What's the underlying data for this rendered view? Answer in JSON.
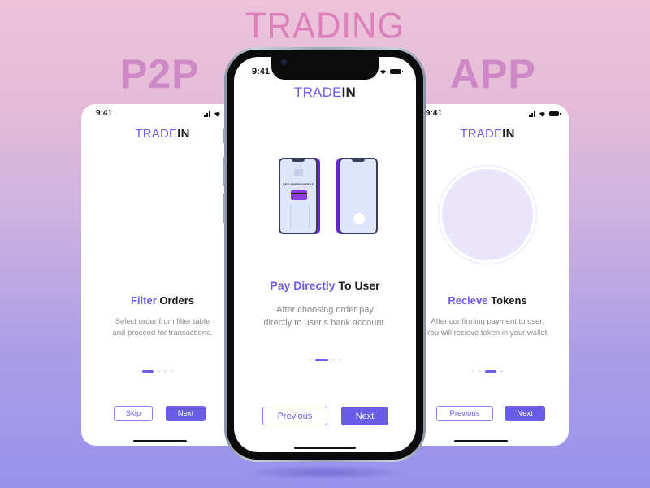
{
  "hero": {
    "top_word": "TRADING",
    "left_word": "P2P",
    "right_word": "APP"
  },
  "brand": {
    "logo_part1": "TRADE",
    "logo_part2": "IN",
    "accent_color": "#6b5ce7"
  },
  "status_bar": {
    "time": "9:41"
  },
  "screens": [
    {
      "id": "filter-orders",
      "title_accent": "Filter",
      "title_rest": " Orders",
      "description_line1": "Select order from filter table",
      "description_line2": "and proceed for transactions.",
      "page_index": 1,
      "page_count": 4,
      "buttons": {
        "secondary": "Skip",
        "primary": "Next"
      }
    },
    {
      "id": "pay-directly",
      "title_accent": "Pay Directly",
      "title_rest": " To User",
      "description_line1": "After choosing order pay",
      "description_line2": "directly to user’s bank account.",
      "illustration_label": "SECURE PAYMENT",
      "page_index": 2,
      "page_count": 4,
      "buttons": {
        "secondary": "Previous",
        "primary": "Next"
      }
    },
    {
      "id": "receive-tokens",
      "title_accent": "Recieve",
      "title_rest": " Tokens",
      "description_line1": "After confirming payment to user.",
      "description_line2": "You will recieve token in your wallet.",
      "page_index": 3,
      "page_count": 4,
      "buttons": {
        "secondary": "Previous",
        "primary": "Next"
      }
    }
  ],
  "icons": {
    "signal": "cellular-signal-icon",
    "wifi": "wifi-icon",
    "battery": "battery-icon"
  }
}
